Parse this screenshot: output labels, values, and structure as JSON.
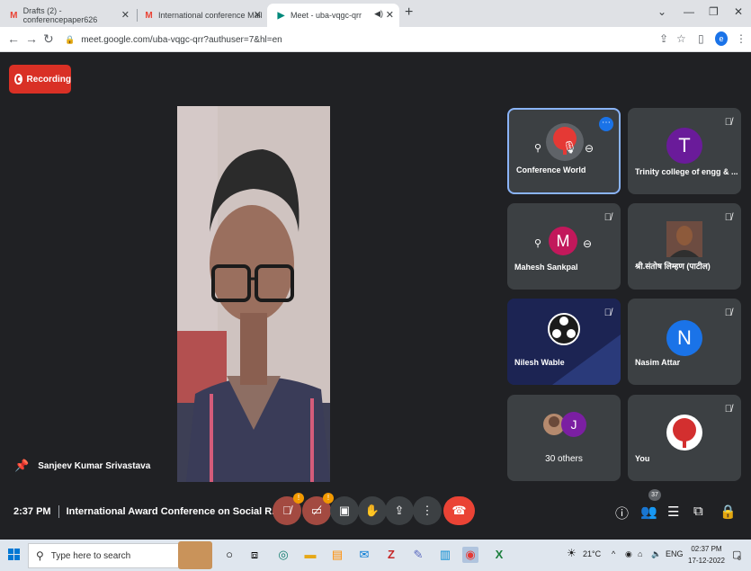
{
  "browser": {
    "tabs": [
      {
        "label": "Drafts (2) - conferencepaper626",
        "icon": "gmail-icon"
      },
      {
        "label": "International conference Mail",
        "icon": "gmail-icon"
      },
      {
        "label": "Meet - uba-vqgc-qrr",
        "icon": "meet-icon",
        "active": true
      }
    ],
    "url": "meet.google.com/uba-vqgc-qrr?authuser=7&hl=en",
    "profile_initial": "e"
  },
  "meet": {
    "recording_label": "Recording",
    "speaker_name": "Sanjeev Kumar Srivastava",
    "time": "2:37 PM",
    "meeting_title": "International Award Conference on Social R...",
    "participant_count": "37",
    "mic_badge": "!",
    "cam_badge": "!",
    "tiles": [
      {
        "name": "Conference World",
        "avatar": "tree-logo",
        "color": "#ff4a3d"
      },
      {
        "name": "Trinity college of engg & ...",
        "initial": "T",
        "color": "#6a1b9a"
      },
      {
        "name": "Mahesh Sankpal",
        "initial": "M",
        "color": "#c2185b"
      },
      {
        "name": "श्री.संतोष लिम्हण (पाटील)",
        "avatar": "photo"
      },
      {
        "name": "Nilesh Wable",
        "avatar": "obs-logo"
      },
      {
        "name": "Nasim Attar",
        "initial": "N",
        "color": "#1a73e8"
      },
      {
        "name": "30 others",
        "initial": "J",
        "color": "#7b1fa2"
      },
      {
        "name": "You",
        "avatar": "tree-logo"
      }
    ]
  },
  "taskbar": {
    "search_placeholder": "Type here to search",
    "weather": "21°C",
    "language": "ENG",
    "time": "02:37 PM",
    "date": "17-12-2022",
    "notif_count": "6"
  }
}
